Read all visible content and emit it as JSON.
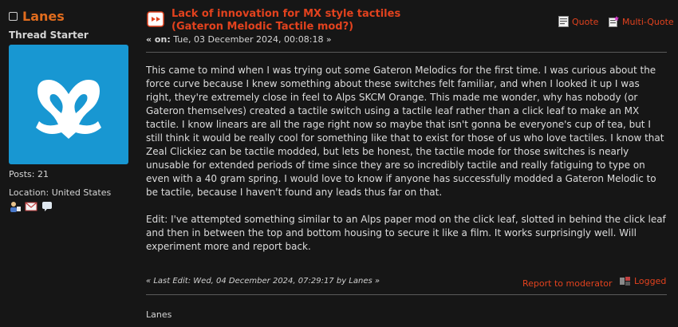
{
  "poster": {
    "name": "Lanes",
    "title": "Thread Starter",
    "posts": "Posts: 21",
    "location": "Location: United States",
    "avatar_color": "#1897d2",
    "icons": [
      "profile-icon",
      "email-icon",
      "personal-message-icon"
    ]
  },
  "post": {
    "title_line1": "Lack of innovation for MX style tactiles",
    "title_line2": "(Gateron Melodic Tactile mod?)",
    "date_prefix": "« on:",
    "date": "Tue, 03 December 2024, 00:08:18 »",
    "body_p1": "This came to mind when I was trying out some Gateron Melodics for the first time. I was curious about the force curve because I knew something about these switches felt familiar, and when I looked it up I was right, they're extremely close in feel to Alps SKCM Orange. This made me wonder, why has nobody (or Gateron themselves) created a tactile switch using a tactile leaf rather than a click leaf to make an MX tactile. I know linears are all the rage right now so maybe that isn't gonna be everyone's cup of tea, but I still think it would be really cool for something like that to exist for those of us who love tactiles. I know that Zeal Clickiez can be tactile modded, but lets be honest, the tactile mode for those switches is nearly unusable for extended periods of time since they are so incredibly tactile and really fatiguing to type on even with a 40 gram spring.  I would love to know if anyone has successfully modded a Gateron Melodic to be tactile, because I haven't found any leads thus far on that.",
    "body_p2": "Edit: I've attempted something similar to an Alps paper mod on the click leaf, slotted in behind the click leaf and then in between the top and bottom housing to secure it like a film. It works surprisingly well. Will experiment more and report back.",
    "last_edit": "« Last Edit: Wed, 04 December 2024, 07:29:17 by Lanes »",
    "signature": "Lanes"
  },
  "actions": {
    "quote": "Quote",
    "multi_quote": "Multi-Quote",
    "report": "Report to moderator",
    "logged": "Logged"
  },
  "colors": {
    "accent": "#e2421e",
    "poster_name": "#e06c1e",
    "background": "#161616"
  }
}
